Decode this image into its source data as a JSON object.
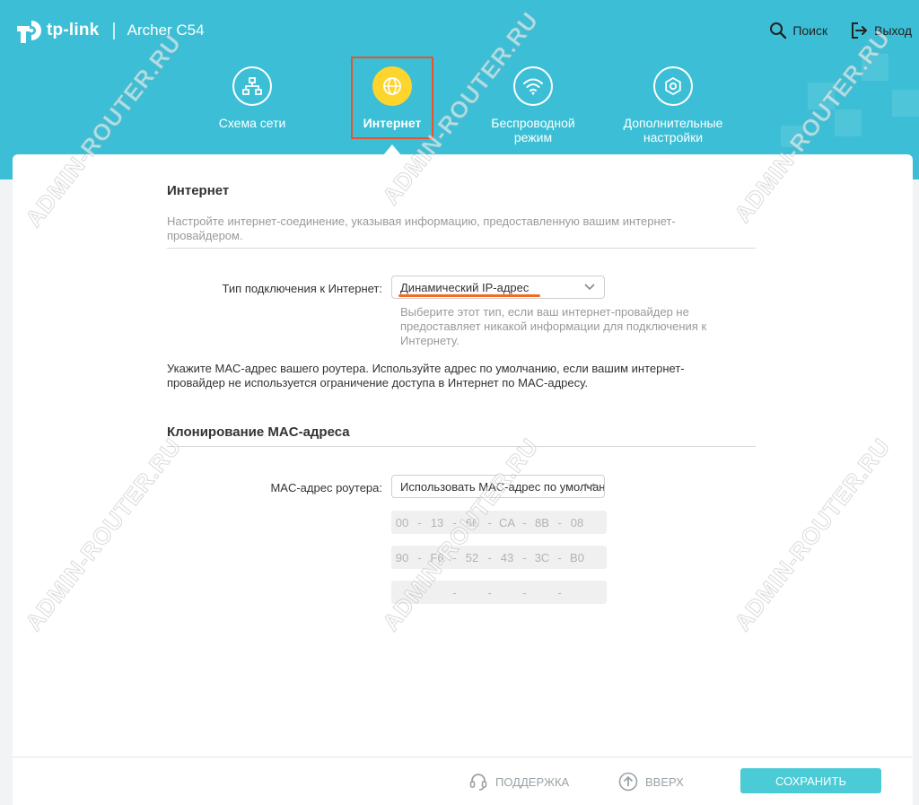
{
  "header": {
    "brand": "tp-link",
    "separator": "|",
    "model": "Archer C54",
    "search_label": "Поиск",
    "logout_label": "Выход",
    "bg_color": "#3cbfd6"
  },
  "nav": {
    "items": [
      {
        "label": "Схема сети",
        "icon": "network-map-icon"
      },
      {
        "label": "Интернет",
        "icon": "globe-icon",
        "active": true
      },
      {
        "label": "Беспроводной режим",
        "icon": "wifi-icon"
      },
      {
        "label": "Дополнительные настройки",
        "icon": "gear-icon"
      }
    ],
    "active_color": "#fdd52c",
    "highlight_color": "#e3552e"
  },
  "internet": {
    "title": "Интернет",
    "description": "Настройте интернет-соединение, указывая информацию, предоставленную вашим интернет-провайдером.",
    "connection_type_label": "Тип подключения к Интернет:",
    "connection_type_value": "Динамический IP-адрес",
    "connection_type_hint": "Выберите этот тип, если ваш интернет-провайдер не предоставляет никакой информации для подключения к Интернету.",
    "mac_note": "Укажите MAC-адрес вашего роутера. Используйте адрес по умолчанию, если вашим интернет-провайдер не используется ограничение доступа в Интернет по MAC-адресу."
  },
  "mac_clone": {
    "title": "Клонирование MAC-адреса",
    "router_mac_label": "MAC-адрес роутера:",
    "router_mac_value": "Использовать MAC-адрес по умолчанию",
    "rows": [
      [
        "00",
        "13",
        "66",
        "CA",
        "8B",
        "08"
      ],
      [
        "90",
        "F6",
        "52",
        "43",
        "3C",
        "B0"
      ],
      [
        "",
        "",
        "",
        "",
        "",
        ""
      ]
    ]
  },
  "footer": {
    "support_label": "ПОДДЕРЖКА",
    "top_label": "ВВЕРХ",
    "save_label": "СОХРАНИТЬ",
    "save_color": "#4acbd6"
  },
  "watermark": "ADMIN-ROUTER.RU"
}
